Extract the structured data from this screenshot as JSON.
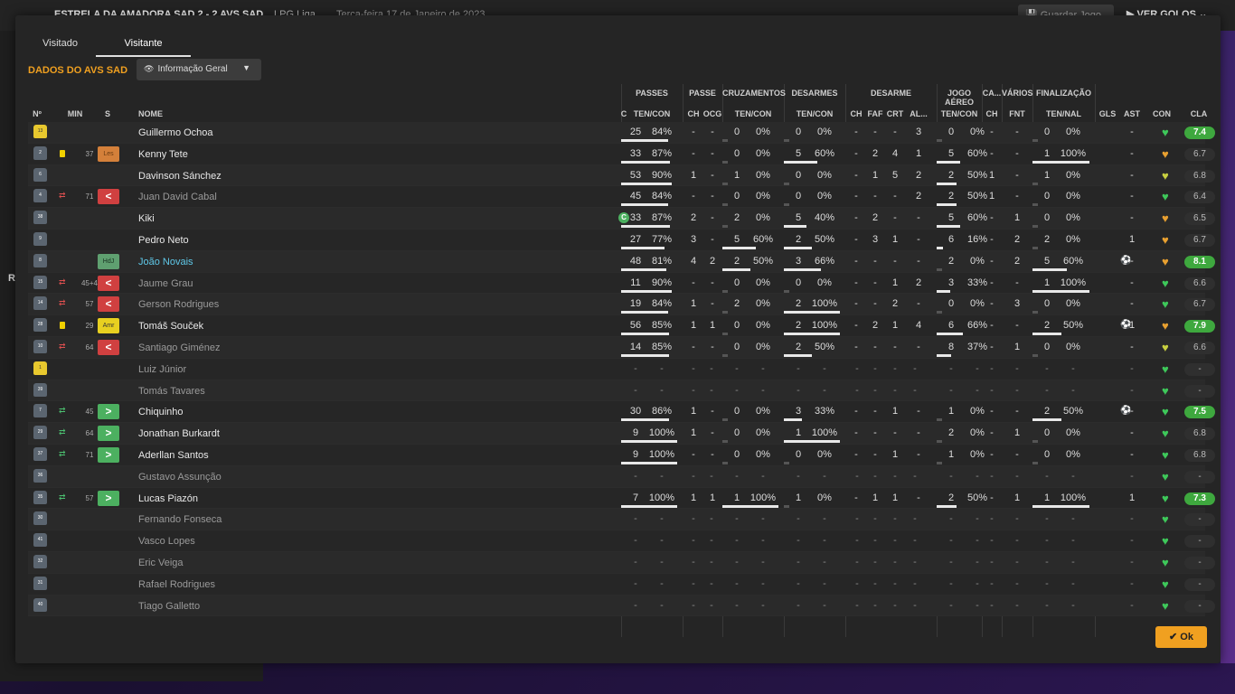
{
  "topbar": {
    "match": "ESTRELA DA AMADORA SAD  2 - 2  AVS SAD",
    "competition": "LPG Liga",
    "date": "Terça-feira 17 de Janeiro de 2023",
    "save_label": "Guardar Jogo",
    "goals_label": "VER GOLOS"
  },
  "left_panel": {
    "letter": "R"
  },
  "tabs": [
    {
      "label": "Visitado"
    },
    {
      "label": "Visitante"
    }
  ],
  "section_title": "DADOS DO AVS SAD",
  "view_selector": {
    "label": "Informação Geral"
  },
  "groups": {
    "passes": "PASSES",
    "passe": "PASSE",
    "cruzamentos": "CRUZAMENTOS",
    "desarmes": "DESARMES",
    "desarme": "DESARME",
    "jogo_aereo": "JOGO AÉREO",
    "ca": "CA...",
    "varios": "VÁRIOS",
    "finalizacao": "FINALIZAÇÃO"
  },
  "columns": {
    "num": "Nº",
    "min": "MIN",
    "s": "S",
    "nome": "NOME",
    "c": "C",
    "pass_tc": "TEN/CON",
    "ch1": "CH",
    "ocg": "OCG",
    "cruz_tc": "TEN/CON",
    "des_tc": "TEN/CON",
    "ch2": "CH",
    "faf": "FAF",
    "crt": "CRT",
    "al": "AL...",
    "aer_tc": "TEN/CON",
    "ch3": "CH",
    "fnt": "FNT",
    "fin_tn": "TEN/NAL",
    "gls": "GLS",
    "ast": "AST",
    "con": "CON",
    "cla": "CLA"
  },
  "rows": [
    {
      "num": "13",
      "gk": true,
      "card": false,
      "sub": "",
      "min": "",
      "pos": "",
      "name": "Guillermo Ochoa",
      "style": "",
      "cap": false,
      "p_t": "25",
      "p_c": "84%",
      "p_bar": 0.84,
      "ch1": "-",
      "ocg": "-",
      "cr_t": "0",
      "cr_c": "0%",
      "cr_bar": 0,
      "de_t": "0",
      "de_c": "0%",
      "de_bar": 0,
      "ch2": "-",
      "faf": "-",
      "crt": "-",
      "al": "3",
      "ae_t": "0",
      "ae_c": "0%",
      "ae_bar": 0,
      "ch3": "-",
      "fnt": "-",
      "fi_t": "0",
      "fi_c": "0%",
      "fi_bar": 0,
      "gls": "",
      "ast": "-",
      "heart": "green",
      "cla": "7.4",
      "good": true
    },
    {
      "num": "2",
      "gk": false,
      "card": true,
      "sub": "",
      "min": "37",
      "pos": "Les",
      "posclass": "les",
      "name": "Kenny Tete",
      "style": "",
      "cap": false,
      "p_t": "33",
      "p_c": "87%",
      "p_bar": 0.87,
      "ch1": "-",
      "ocg": "-",
      "cr_t": "0",
      "cr_c": "0%",
      "cr_bar": 0,
      "de_t": "5",
      "de_c": "60%",
      "de_bar": 0.6,
      "ch2": "-",
      "faf": "2",
      "crt": "4",
      "al": "1",
      "ae_t": "5",
      "ae_c": "60%",
      "ae_bar": 0.6,
      "ch3": "-",
      "fnt": "-",
      "fi_t": "1",
      "fi_c": "100%",
      "fi_bar": 1,
      "gls": "",
      "ast": "-",
      "heart": "orange",
      "cla": "6.7",
      "good": false
    },
    {
      "num": "6",
      "gk": false,
      "card": false,
      "sub": "",
      "min": "",
      "pos": "",
      "name": "Davinson Sánchez",
      "style": "",
      "cap": false,
      "p_t": "53",
      "p_c": "90%",
      "p_bar": 0.9,
      "ch1": "1",
      "ocg": "-",
      "cr_t": "1",
      "cr_c": "0%",
      "cr_bar": 0,
      "de_t": "0",
      "de_c": "0%",
      "de_bar": 0,
      "ch2": "-",
      "faf": "1",
      "crt": "5",
      "al": "2",
      "ae_t": "2",
      "ae_c": "50%",
      "ae_bar": 0.5,
      "ch3": "1",
      "fnt": "-",
      "fi_t": "1",
      "fi_c": "0%",
      "fi_bar": 0,
      "gls": "",
      "ast": "-",
      "heart": "yellow",
      "cla": "6.8",
      "good": false
    },
    {
      "num": "4",
      "gk": false,
      "card": false,
      "sub": "out",
      "min": "71",
      "pos": "<",
      "posclass": "out",
      "name": "Juan David Cabal",
      "style": "dim",
      "cap": false,
      "p_t": "45",
      "p_c": "84%",
      "p_bar": 0.84,
      "ch1": "-",
      "ocg": "-",
      "cr_t": "0",
      "cr_c": "0%",
      "cr_bar": 0,
      "de_t": "0",
      "de_c": "0%",
      "de_bar": 0,
      "ch2": "-",
      "faf": "-",
      "crt": "-",
      "al": "2",
      "ae_t": "2",
      "ae_c": "50%",
      "ae_bar": 0.5,
      "ch3": "1",
      "fnt": "-",
      "fi_t": "0",
      "fi_c": "0%",
      "fi_bar": 0,
      "gls": "",
      "ast": "-",
      "heart": "green",
      "cla": "6.4",
      "good": false
    },
    {
      "num": "38",
      "gk": false,
      "card": false,
      "sub": "",
      "min": "",
      "pos": "",
      "name": "Kiki",
      "style": "",
      "cap": true,
      "p_t": "33",
      "p_c": "87%",
      "p_bar": 0.87,
      "ch1": "2",
      "ocg": "-",
      "cr_t": "2",
      "cr_c": "0%",
      "cr_bar": 0,
      "de_t": "5",
      "de_c": "40%",
      "de_bar": 0.4,
      "ch2": "-",
      "faf": "2",
      "crt": "-",
      "al": "-",
      "ae_t": "5",
      "ae_c": "60%",
      "ae_bar": 0.6,
      "ch3": "-",
      "fnt": "1",
      "fi_t": "0",
      "fi_c": "0%",
      "fi_bar": 0,
      "gls": "",
      "ast": "-",
      "heart": "orange",
      "cla": "6.5",
      "good": false
    },
    {
      "num": "9",
      "gk": false,
      "card": false,
      "sub": "",
      "min": "",
      "pos": "",
      "name": "Pedro Neto",
      "style": "",
      "cap": false,
      "p_t": "27",
      "p_c": "77%",
      "p_bar": 0.77,
      "ch1": "3",
      "ocg": "-",
      "cr_t": "5",
      "cr_c": "60%",
      "cr_bar": 0.6,
      "de_t": "2",
      "de_c": "50%",
      "de_bar": 0.5,
      "ch2": "-",
      "faf": "3",
      "crt": "1",
      "al": "-",
      "ae_t": "6",
      "ae_c": "16%",
      "ae_bar": 0.16,
      "ch3": "-",
      "fnt": "2",
      "fi_t": "2",
      "fi_c": "0%",
      "fi_bar": 0,
      "gls": "",
      "ast": "1",
      "heart": "orange",
      "cla": "6.7",
      "good": false
    },
    {
      "num": "8",
      "gk": false,
      "card": false,
      "sub": "",
      "min": "",
      "pos": "HdJ",
      "posclass": "hdj",
      "name": "João Novais",
      "style": "hl",
      "cap": false,
      "p_t": "48",
      "p_c": "81%",
      "p_bar": 0.81,
      "ch1": "4",
      "ocg": "2",
      "cr_t": "2",
      "cr_c": "50%",
      "cr_bar": 0.5,
      "de_t": "3",
      "de_c": "66%",
      "de_bar": 0.66,
      "ch2": "-",
      "faf": "-",
      "crt": "-",
      "al": "-",
      "ae_t": "2",
      "ae_c": "0%",
      "ae_bar": 0,
      "ch3": "-",
      "fnt": "2",
      "fi_t": "5",
      "fi_c": "60%",
      "fi_bar": 0.6,
      "gls": "ball",
      "ast": "-",
      "heart": "orange",
      "cla": "8.1",
      "good": true
    },
    {
      "num": "15",
      "gk": false,
      "card": false,
      "sub": "out",
      "min": "45+4",
      "pos": "<",
      "posclass": "out",
      "name": "Jaume Grau",
      "style": "dim",
      "cap": false,
      "p_t": "11",
      "p_c": "90%",
      "p_bar": 0.9,
      "ch1": "-",
      "ocg": "-",
      "cr_t": "0",
      "cr_c": "0%",
      "cr_bar": 0,
      "de_t": "0",
      "de_c": "0%",
      "de_bar": 0,
      "ch2": "-",
      "faf": "-",
      "crt": "1",
      "al": "2",
      "ae_t": "3",
      "ae_c": "33%",
      "ae_bar": 0.33,
      "ch3": "-",
      "fnt": "-",
      "fi_t": "1",
      "fi_c": "100%",
      "fi_bar": 1,
      "gls": "",
      "ast": "-",
      "heart": "green",
      "cla": "6.6",
      "good": false
    },
    {
      "num": "14",
      "gk": false,
      "card": false,
      "sub": "out",
      "min": "57",
      "pos": "<",
      "posclass": "out",
      "name": "Gerson Rodrigues",
      "style": "dim",
      "cap": false,
      "p_t": "19",
      "p_c": "84%",
      "p_bar": 0.84,
      "ch1": "1",
      "ocg": "-",
      "cr_t": "2",
      "cr_c": "0%",
      "cr_bar": 0,
      "de_t": "2",
      "de_c": "100%",
      "de_bar": 1,
      "ch2": "-",
      "faf": "-",
      "crt": "2",
      "al": "-",
      "ae_t": "0",
      "ae_c": "0%",
      "ae_bar": 0,
      "ch3": "-",
      "fnt": "3",
      "fi_t": "0",
      "fi_c": "0%",
      "fi_bar": 0,
      "gls": "",
      "ast": "-",
      "heart": "green",
      "cla": "6.7",
      "good": false
    },
    {
      "num": "28",
      "gk": false,
      "card": true,
      "sub": "",
      "min": "29",
      "pos": "Amr",
      "posclass": "amr",
      "name": "Tomáš Souček",
      "style": "",
      "cap": false,
      "p_t": "56",
      "p_c": "85%",
      "p_bar": 0.85,
      "ch1": "1",
      "ocg": "1",
      "cr_t": "0",
      "cr_c": "0%",
      "cr_bar": 0,
      "de_t": "2",
      "de_c": "100%",
      "de_bar": 1,
      "ch2": "-",
      "faf": "2",
      "crt": "1",
      "al": "4",
      "ae_t": "6",
      "ae_c": "66%",
      "ae_bar": 0.66,
      "ch3": "-",
      "fnt": "-",
      "fi_t": "2",
      "fi_c": "50%",
      "fi_bar": 0.5,
      "gls": "ball",
      "ast": "1",
      "heart": "orange",
      "cla": "7.9",
      "good": true
    },
    {
      "num": "10",
      "gk": false,
      "card": false,
      "sub": "out",
      "min": "64",
      "pos": "<",
      "posclass": "out",
      "name": "Santiago Giménez",
      "style": "dim",
      "cap": false,
      "p_t": "14",
      "p_c": "85%",
      "p_bar": 0.85,
      "ch1": "-",
      "ocg": "-",
      "cr_t": "0",
      "cr_c": "0%",
      "cr_bar": 0,
      "de_t": "2",
      "de_c": "50%",
      "de_bar": 0.5,
      "ch2": "-",
      "faf": "-",
      "crt": "-",
      "al": "-",
      "ae_t": "8",
      "ae_c": "37%",
      "ae_bar": 0.37,
      "ch3": "-",
      "fnt": "1",
      "fi_t": "0",
      "fi_c": "0%",
      "fi_bar": 0,
      "gls": "",
      "ast": "-",
      "heart": "yellow",
      "cla": "6.6",
      "good": false
    },
    {
      "num": "1",
      "gk": true,
      "card": false,
      "sub": "",
      "min": "",
      "pos": "",
      "name": "Luiz Júnior",
      "style": "dim",
      "cap": false,
      "empty": true,
      "heart": "green",
      "cla": "-",
      "good": false
    },
    {
      "num": "39",
      "gk": false,
      "card": false,
      "sub": "",
      "min": "",
      "pos": "",
      "name": "Tomás Tavares",
      "style": "dim",
      "cap": false,
      "empty": true,
      "heart": "green",
      "cla": "-",
      "good": false
    },
    {
      "num": "7",
      "gk": false,
      "card": false,
      "sub": "in",
      "min": "45",
      "pos": ">",
      "posclass": "in",
      "name": "Chiquinho",
      "style": "",
      "cap": false,
      "p_t": "30",
      "p_c": "86%",
      "p_bar": 0.86,
      "ch1": "1",
      "ocg": "-",
      "cr_t": "0",
      "cr_c": "0%",
      "cr_bar": 0,
      "de_t": "3",
      "de_c": "33%",
      "de_bar": 0.33,
      "ch2": "-",
      "faf": "-",
      "crt": "1",
      "al": "-",
      "ae_t": "1",
      "ae_c": "0%",
      "ae_bar": 0,
      "ch3": "-",
      "fnt": "-",
      "fi_t": "2",
      "fi_c": "50%",
      "fi_bar": 0.5,
      "gls": "ball",
      "ast": "-",
      "heart": "green",
      "cla": "7.5",
      "good": true
    },
    {
      "num": "29",
      "gk": false,
      "card": false,
      "sub": "in",
      "min": "64",
      "pos": ">",
      "posclass": "in",
      "name": "Jonathan Burkardt",
      "style": "",
      "cap": false,
      "p_t": "9",
      "p_c": "100%",
      "p_bar": 1,
      "ch1": "1",
      "ocg": "-",
      "cr_t": "0",
      "cr_c": "0%",
      "cr_bar": 0,
      "de_t": "1",
      "de_c": "100%",
      "de_bar": 1,
      "ch2": "-",
      "faf": "-",
      "crt": "-",
      "al": "-",
      "ae_t": "2",
      "ae_c": "0%",
      "ae_bar": 0,
      "ch3": "-",
      "fnt": "1",
      "fi_t": "0",
      "fi_c": "0%",
      "fi_bar": 0,
      "gls": "",
      "ast": "-",
      "heart": "green",
      "cla": "6.8",
      "good": false
    },
    {
      "num": "37",
      "gk": false,
      "card": false,
      "sub": "in",
      "min": "71",
      "pos": ">",
      "posclass": "in",
      "name": "Aderllan Santos",
      "style": "",
      "cap": false,
      "p_t": "9",
      "p_c": "100%",
      "p_bar": 1,
      "ch1": "-",
      "ocg": "-",
      "cr_t": "0",
      "cr_c": "0%",
      "cr_bar": 0,
      "de_t": "0",
      "de_c": "0%",
      "de_bar": 0,
      "ch2": "-",
      "faf": "-",
      "crt": "1",
      "al": "-",
      "ae_t": "1",
      "ae_c": "0%",
      "ae_bar": 0,
      "ch3": "-",
      "fnt": "-",
      "fi_t": "0",
      "fi_c": "0%",
      "fi_bar": 0,
      "gls": "",
      "ast": "-",
      "heart": "green",
      "cla": "6.8",
      "good": false
    },
    {
      "num": "36",
      "gk": false,
      "card": false,
      "sub": "",
      "min": "",
      "pos": "",
      "name": "Gustavo Assunção",
      "style": "dim",
      "cap": false,
      "empty": true,
      "heart": "green",
      "cla": "-",
      "good": false
    },
    {
      "num": "35",
      "gk": false,
      "card": false,
      "sub": "in",
      "min": "57",
      "pos": ">",
      "posclass": "in",
      "name": "Lucas Piazón",
      "style": "",
      "cap": false,
      "p_t": "7",
      "p_c": "100%",
      "p_bar": 1,
      "ch1": "1",
      "ocg": "1",
      "cr_t": "1",
      "cr_c": "100%",
      "cr_bar": 1,
      "de_t": "1",
      "de_c": "0%",
      "de_bar": 0,
      "ch2": "-",
      "faf": "1",
      "crt": "1",
      "al": "-",
      "ae_t": "2",
      "ae_c": "50%",
      "ae_bar": 0.5,
      "ch3": "-",
      "fnt": "1",
      "fi_t": "1",
      "fi_c": "100%",
      "fi_bar": 1,
      "gls": "",
      "ast": "1",
      "heart": "green",
      "cla": "7.3",
      "good": true
    },
    {
      "num": "30",
      "gk": false,
      "card": false,
      "sub": "",
      "min": "",
      "pos": "",
      "name": "Fernando Fonseca",
      "style": "dim",
      "cap": false,
      "empty": true,
      "heart": "green",
      "cla": "-",
      "good": false
    },
    {
      "num": "41",
      "gk": false,
      "card": false,
      "sub": "",
      "min": "",
      "pos": "",
      "name": "Vasco Lopes",
      "style": "dim",
      "cap": false,
      "empty": true,
      "heart": "green",
      "cla": "-",
      "good": false
    },
    {
      "num": "32",
      "gk": false,
      "card": false,
      "sub": "",
      "min": "",
      "pos": "",
      "name": "Eric Veiga",
      "style": "dim",
      "cap": false,
      "empty": true,
      "heart": "green",
      "cla": "-",
      "good": false
    },
    {
      "num": "31",
      "gk": false,
      "card": false,
      "sub": "",
      "min": "",
      "pos": "",
      "name": "Rafael Rodrigues",
      "style": "dim",
      "cap": false,
      "empty": true,
      "heart": "green",
      "cla": "-",
      "good": false
    },
    {
      "num": "40",
      "gk": false,
      "card": false,
      "sub": "",
      "min": "",
      "pos": "",
      "name": "Tiago Galletto",
      "style": "dim",
      "cap": false,
      "empty": true,
      "heart": "green",
      "cla": "-",
      "good": false
    }
  ],
  "ok_label": "Ok",
  "colors": {
    "accent": "#f0a020",
    "good_rating": "#3ea83e",
    "highlight": "#5fc8e8"
  }
}
